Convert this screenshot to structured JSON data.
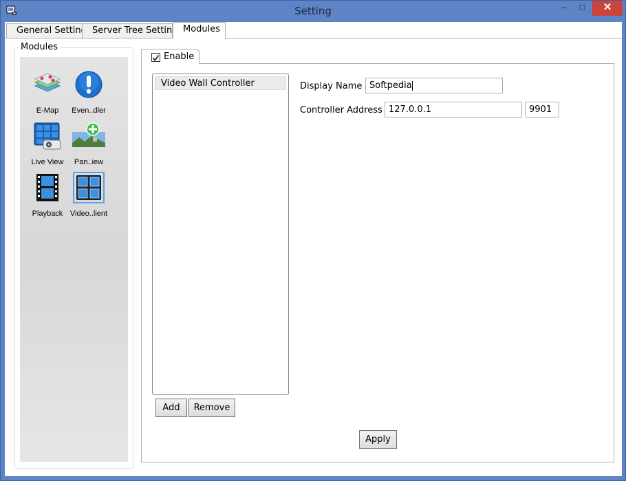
{
  "window": {
    "title": "Setting",
    "minimize_glyph": "–",
    "maximize_glyph": "□",
    "close_glyph": "✕"
  },
  "tabs": [
    {
      "label": "General Setting"
    },
    {
      "label": "Server Tree Setting"
    },
    {
      "label": "Modules",
      "active": true
    }
  ],
  "modules": {
    "group_label": "Modules",
    "items": [
      {
        "label": "E-Map",
        "icon": "emap-icon"
      },
      {
        "label": "Even..dler",
        "icon": "event-handler-icon"
      },
      {
        "label": "Live View",
        "icon": "live-view-icon"
      },
      {
        "label": "Pan..iew",
        "icon": "panorama-view-icon"
      },
      {
        "label": "Playback",
        "icon": "playback-icon"
      },
      {
        "label": "Video..lient",
        "icon": "video-wall-client-icon",
        "selected": true
      }
    ]
  },
  "enable": {
    "label": "Enable",
    "checked": true
  },
  "controller_list": {
    "items": [
      "Video Wall Controller"
    ],
    "add_label": "Add",
    "remove_label": "Remove"
  },
  "form": {
    "display_name_label": "Display Name",
    "display_name_value": "Softpedia",
    "controller_address_label": "Controller Address",
    "ip_value": "127.0.0.1",
    "port_value": "9901"
  },
  "apply_label": "Apply",
  "colors": {
    "window_frame": "#5e84c6",
    "close_button": "#c9453a",
    "selection_outline": "#5aa0e6"
  }
}
